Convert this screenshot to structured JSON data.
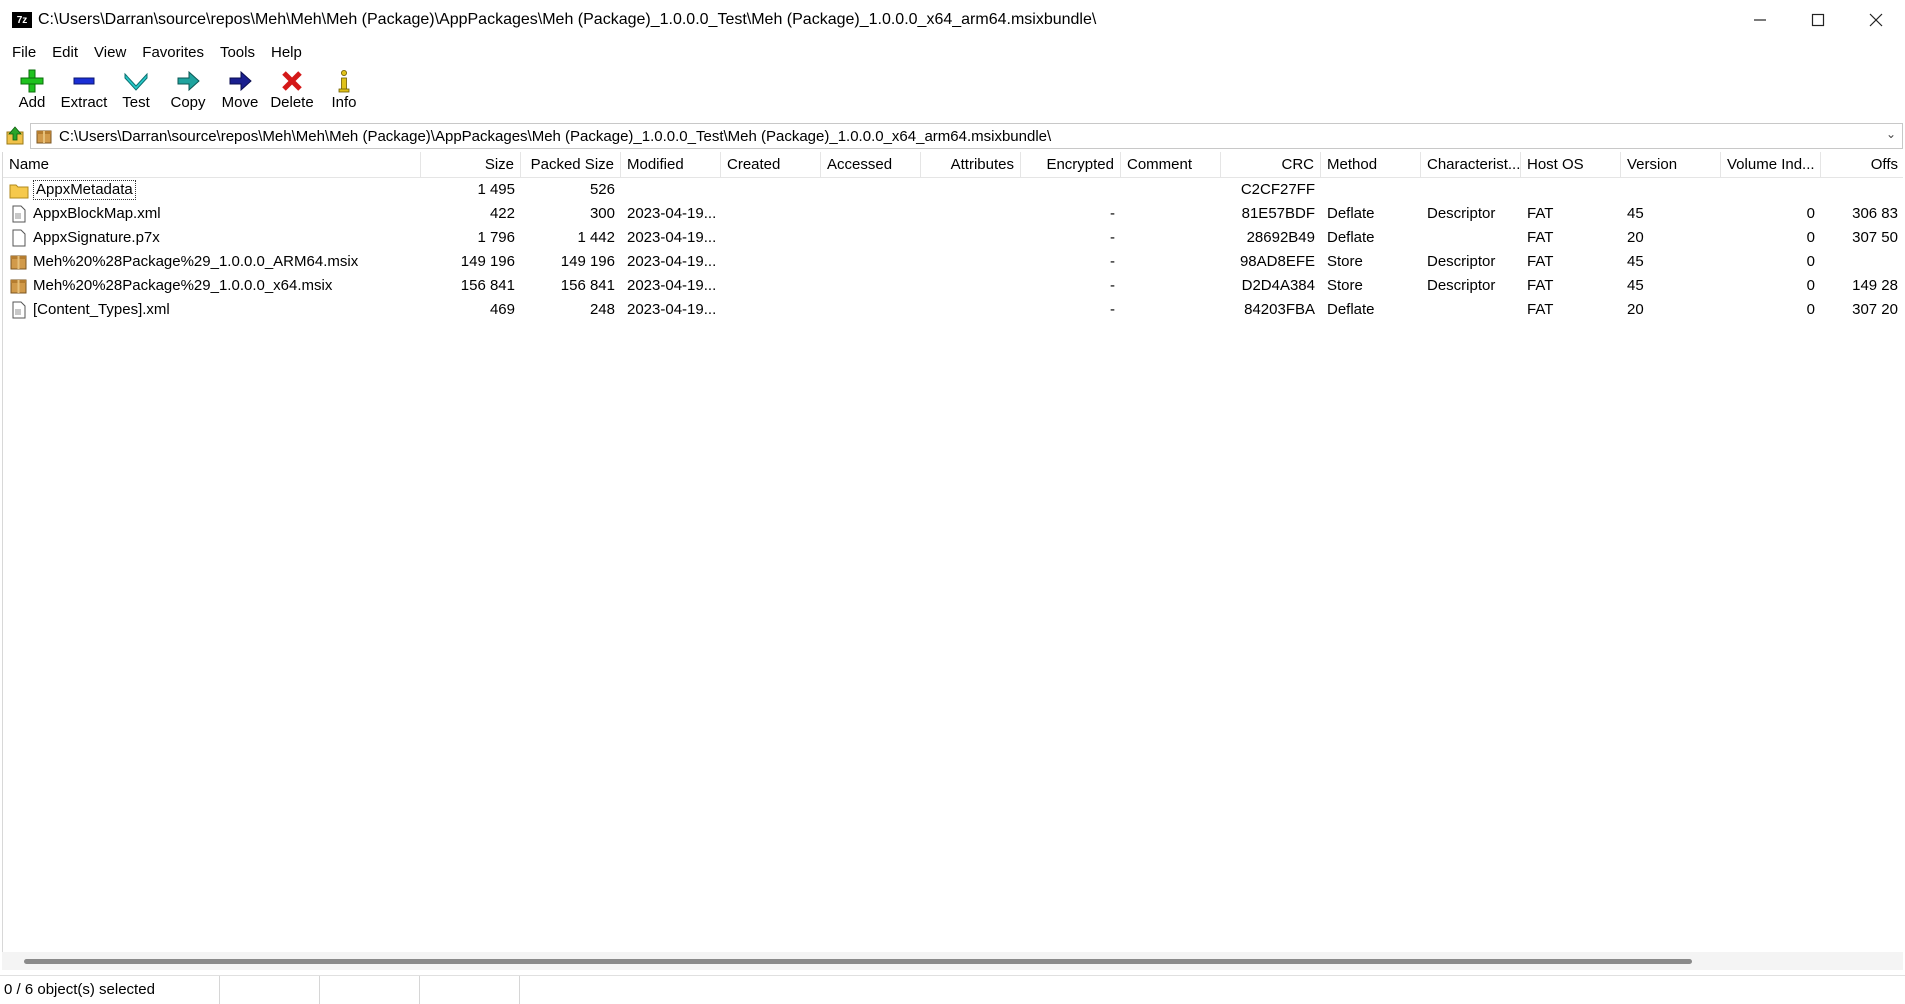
{
  "window": {
    "title": "C:\\Users\\Darran\\source\\repos\\Meh\\Meh\\Meh (Package)\\AppPackages\\Meh (Package)_1.0.0.0_Test\\Meh (Package)_1.0.0.0_x64_arm64.msixbundle\\",
    "app_icon_text": "7z"
  },
  "menu": [
    "File",
    "Edit",
    "View",
    "Favorites",
    "Tools",
    "Help"
  ],
  "toolbar": {
    "add": "Add",
    "extract": "Extract",
    "test": "Test",
    "copy": "Copy",
    "move": "Move",
    "delete": "Delete",
    "info": "Info"
  },
  "address": {
    "path": "C:\\Users\\Darran\\source\\repos\\Meh\\Meh\\Meh (Package)\\AppPackages\\Meh (Package)_1.0.0.0_Test\\Meh (Package)_1.0.0.0_x64_arm64.msixbundle\\"
  },
  "columns": [
    "Name",
    "Size",
    "Packed Size",
    "Modified",
    "Created",
    "Accessed",
    "Attributes",
    "Encrypted",
    "Comment",
    "CRC",
    "Method",
    "Characterist...",
    "Host OS",
    "Version",
    "Volume Ind...",
    "Offs"
  ],
  "rows": [
    {
      "name": "AppxMetadata",
      "size": "1 495",
      "packed": "526",
      "modified": "",
      "encrypted": "",
      "crc": "C2CF27FF",
      "method": "",
      "char": "",
      "host": "",
      "version": "",
      "volume": "",
      "offset": ""
    },
    {
      "name": "AppxBlockMap.xml",
      "size": "422",
      "packed": "300",
      "modified": "2023-04-19...",
      "encrypted": "-",
      "crc": "81E57BDF",
      "method": "Deflate",
      "char": "Descriptor",
      "host": "FAT",
      "version": "45",
      "volume": "0",
      "offset": "306 83"
    },
    {
      "name": "AppxSignature.p7x",
      "size": "1 796",
      "packed": "1 442",
      "modified": "2023-04-19...",
      "encrypted": "-",
      "crc": "28692B49",
      "method": "Deflate",
      "char": "",
      "host": "FAT",
      "version": "20",
      "volume": "0",
      "offset": "307 50"
    },
    {
      "name": "Meh%20%28Package%29_1.0.0.0_ARM64.msix",
      "size": "149 196",
      "packed": "149 196",
      "modified": "2023-04-19...",
      "encrypted": "-",
      "crc": "98AD8EFE",
      "method": "Store",
      "char": "Descriptor",
      "host": "FAT",
      "version": "45",
      "volume": "0",
      "offset": ""
    },
    {
      "name": "Meh%20%28Package%29_1.0.0.0_x64.msix",
      "size": "156 841",
      "packed": "156 841",
      "modified": "2023-04-19...",
      "encrypted": "-",
      "crc": "D2D4A384",
      "method": "Store",
      "char": "Descriptor",
      "host": "FAT",
      "version": "45",
      "volume": "0",
      "offset": "149 28"
    },
    {
      "name": "[Content_Types].xml",
      "size": "469",
      "packed": "248",
      "modified": "2023-04-19...",
      "encrypted": "-",
      "crc": "84203FBA",
      "method": "Deflate",
      "char": "",
      "host": "FAT",
      "version": "20",
      "volume": "0",
      "offset": "307 20"
    }
  ],
  "status": {
    "selected": "0 / 6 object(s) selected"
  }
}
